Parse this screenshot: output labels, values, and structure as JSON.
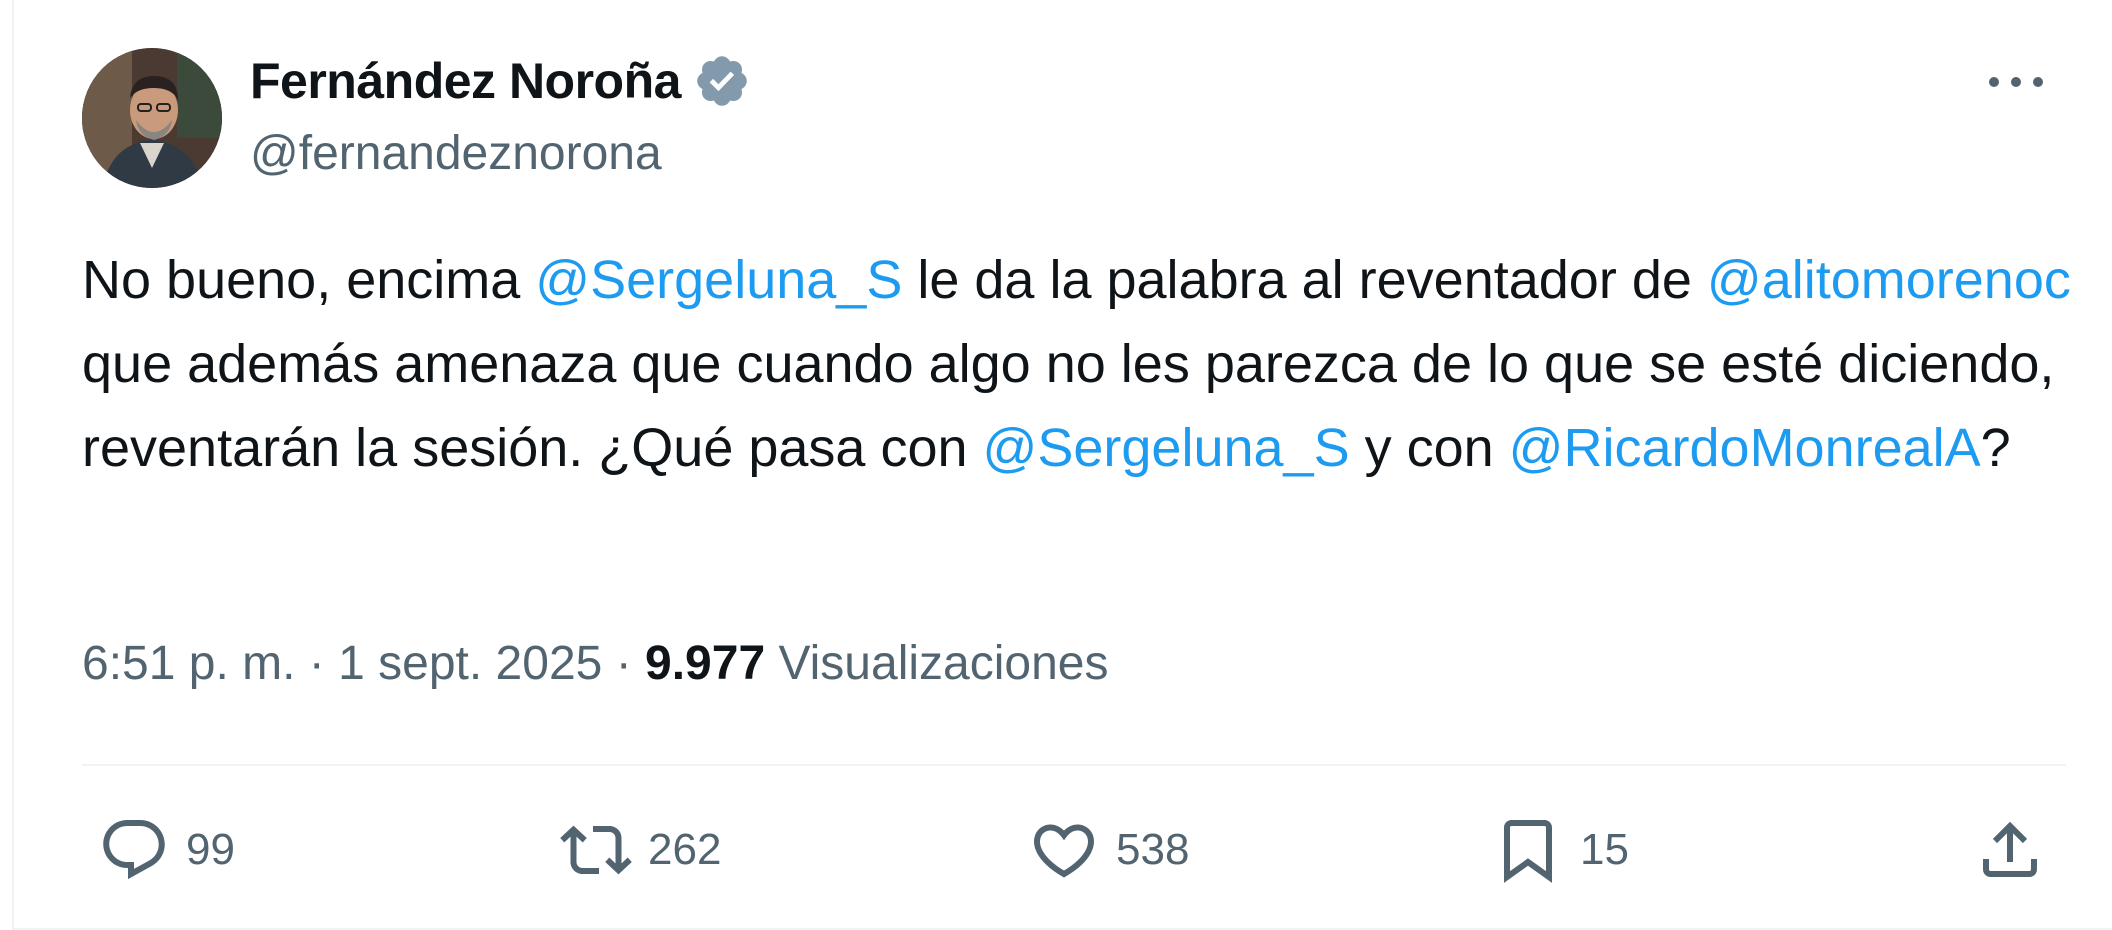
{
  "author": {
    "display_name": "Fernández Noroña",
    "handle": "@fernandeznorona",
    "verified_icon": "verified-badge-icon"
  },
  "tweet": {
    "parts": [
      {
        "t": "No bueno, encima "
      },
      {
        "t": "@Sergeluna_S",
        "mention": true
      },
      {
        "t": " le da la palabra al reventador de "
      },
      {
        "t": "@alitomorenoc",
        "mention": true
      },
      {
        "t": " que además amenaza que cuando algo no les parezca de lo que se esté diciendo, reventarán la sesión. ¿Qué pasa con "
      },
      {
        "t": "@Sergeluna_S",
        "mention": true
      },
      {
        "t": " y con "
      },
      {
        "t": "@RicardoMonrealA",
        "mention": true
      },
      {
        "t": "?"
      }
    ]
  },
  "meta": {
    "time": "6:51 p. m.",
    "separator": "·",
    "date": "1 sept. 2025",
    "views_count": "9.977",
    "views_label": "Visualizaciones"
  },
  "actions": {
    "replies": "99",
    "reposts": "262",
    "likes": "538",
    "bookmarks": "15"
  },
  "colors": {
    "mention": "#1d9bf0",
    "secondary_text": "#536471",
    "primary_text": "#0f1419",
    "verified_badge": "#829aab"
  }
}
